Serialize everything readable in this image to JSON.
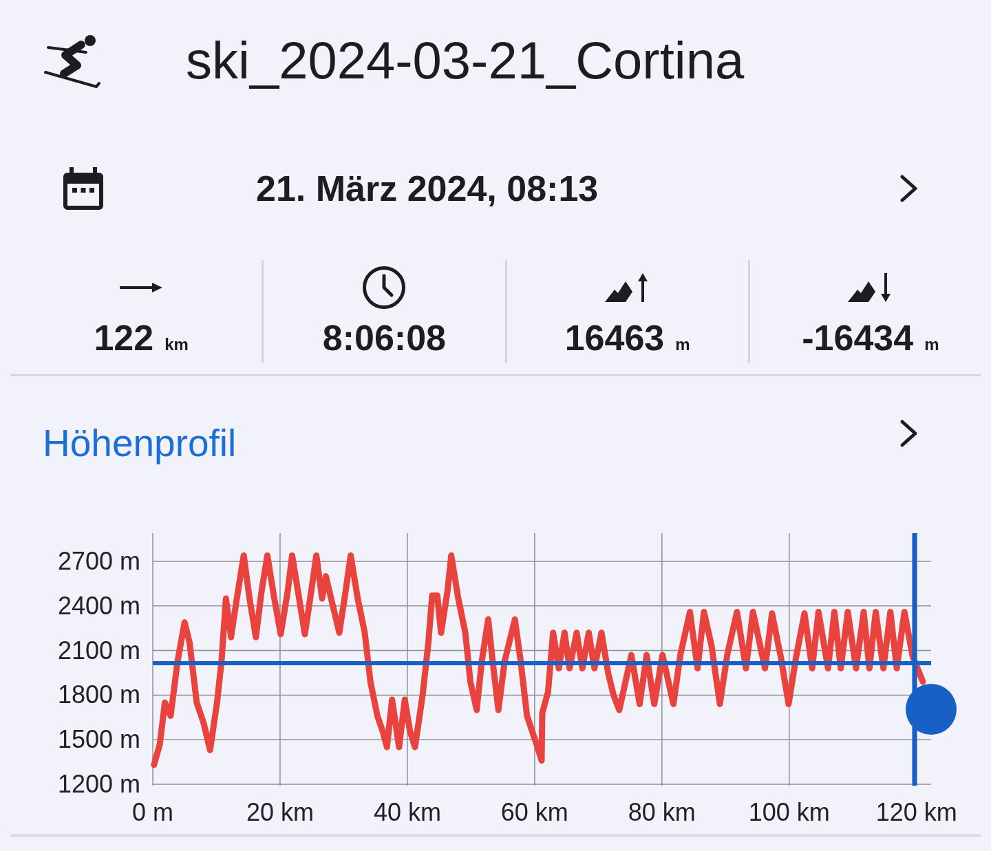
{
  "header": {
    "title": "ski_2024-03-21_Cortina"
  },
  "date_row": {
    "text": "21. März 2024, 08:13"
  },
  "stats": [
    {
      "kind": "distance",
      "value": "122",
      "unit": "km"
    },
    {
      "kind": "duration",
      "value": "8:06:08"
    },
    {
      "kind": "ascent",
      "value": "16463",
      "unit": "m"
    },
    {
      "kind": "descent",
      "value": "-16434",
      "unit": "m"
    }
  ],
  "elevation_profile": {
    "title": "Höhenprofil",
    "chart_data": {
      "type": "line",
      "grid": true,
      "xlim": [
        0,
        122.3
      ],
      "ylim": [
        1200,
        2890
      ],
      "xticks": [
        {
          "value": 0,
          "label": "0 m"
        },
        {
          "value": 20,
          "label": "20 km"
        },
        {
          "value": 40,
          "label": "40 km"
        },
        {
          "value": 60,
          "label": "60 km"
        },
        {
          "value": 80,
          "label": "80 km"
        },
        {
          "value": 100,
          "label": "100 km"
        },
        {
          "value": 120,
          "label": "120 km"
        }
      ],
      "yticks": [
        {
          "value": 1200,
          "label": "1200 m"
        },
        {
          "value": 1500,
          "label": "1500 m"
        },
        {
          "value": 1800,
          "label": "1800 m"
        },
        {
          "value": 2100,
          "label": "2100 m"
        },
        {
          "value": 2400,
          "label": "2400 m"
        },
        {
          "value": 2700,
          "label": "2700 m"
        }
      ],
      "x": [
        0.2,
        1.1,
        1.9,
        2.8,
        3.9,
        5.0,
        5.8,
        6.9,
        8.0,
        9.0,
        10.1,
        10.8,
        11.5,
        12.3,
        13.2,
        14.3,
        15.2,
        16.2,
        17.1,
        18.0,
        19.1,
        20.1,
        21.2,
        21.9,
        23.0,
        23.9,
        24.9,
        25.7,
        26.6,
        27.2,
        28.3,
        29.3,
        30.3,
        31.1,
        32.2,
        33.3,
        34.2,
        35.3,
        36.1,
        36.8,
        37.6,
        38.7,
        39.6,
        40.4,
        41.2,
        42.4,
        43.3,
        43.9,
        44.7,
        45.3,
        46.3,
        46.9,
        48.0,
        49.1,
        49.9,
        50.9,
        51.7,
        52.7,
        53.4,
        54.3,
        55.3,
        56.9,
        57.8,
        58.8,
        60.3,
        61.1,
        61.2,
        62.1,
        62.9,
        63.8,
        64.7,
        65.5,
        66.6,
        67.5,
        68.5,
        69.4,
        70.5,
        71.6,
        72.4,
        73.3,
        75.2,
        76.5,
        77.6,
        78.8,
        80.1,
        81.8,
        82.9,
        84.4,
        85.6,
        86.6,
        87.8,
        89.1,
        90.3,
        91.8,
        93.2,
        94.3,
        96.2,
        97.3,
        98.7,
        99.9,
        101.1,
        102.4,
        103.6,
        104.6,
        106.1,
        107.1,
        108.1,
        109.2,
        110.5,
        111.7,
        112.6,
        113.6,
        114.8,
        115.9,
        116.9,
        118.1,
        119.4,
        121.0
      ],
      "values": [
        1330,
        1470,
        1750,
        1660,
        2030,
        2290,
        2150,
        1750,
        1610,
        1430,
        1750,
        2030,
        2450,
        2190,
        2450,
        2740,
        2450,
        2190,
        2500,
        2740,
        2450,
        2210,
        2500,
        2740,
        2450,
        2210,
        2500,
        2740,
        2450,
        2600,
        2400,
        2220,
        2500,
        2740,
        2450,
        2220,
        1890,
        1660,
        1560,
        1450,
        1770,
        1450,
        1770,
        1560,
        1450,
        1800,
        2150,
        2470,
        2470,
        2220,
        2500,
        2740,
        2450,
        2220,
        1890,
        1700,
        2030,
        2310,
        2030,
        1700,
        2030,
        2310,
        2030,
        1660,
        1470,
        1360,
        1680,
        1820,
        2220,
        1980,
        2220,
        1980,
        2220,
        1980,
        2220,
        1980,
        2220,
        1940,
        1800,
        1700,
        2070,
        1740,
        2070,
        1740,
        2070,
        1740,
        2070,
        2360,
        1980,
        2360,
        2130,
        1740,
        2080,
        2360,
        1980,
        2360,
        1980,
        2350,
        2050,
        1740,
        2060,
        2350,
        1980,
        2360,
        1980,
        2360,
        1980,
        2360,
        1980,
        2360,
        1980,
        2360,
        1980,
        2360,
        1980,
        2360,
        2060,
        1890
      ],
      "ref_lines": [
        {
          "axis": "x",
          "value": 119.7
        },
        {
          "axis": "y",
          "value": 2015
        }
      ]
    }
  }
}
